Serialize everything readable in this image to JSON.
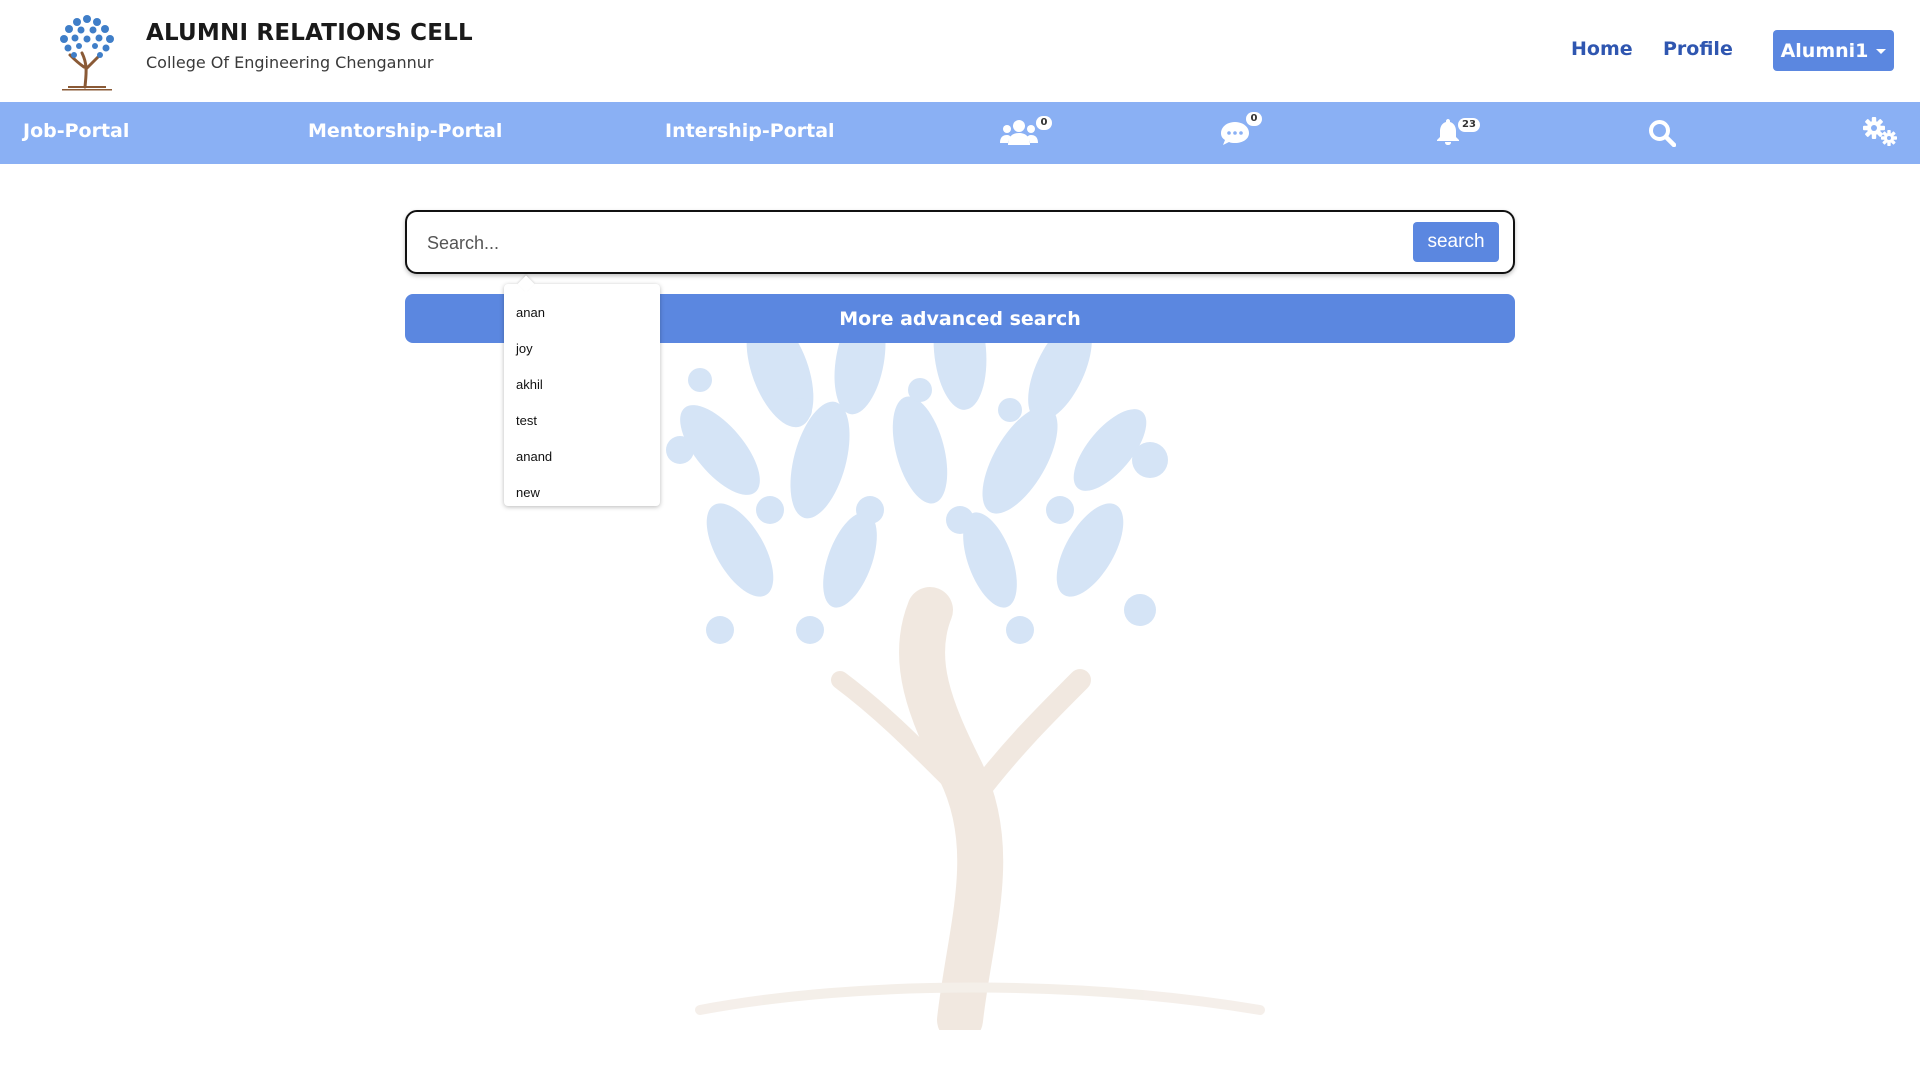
{
  "header": {
    "title": "ALUMNI RELATIONS CELL",
    "subtitle": "College Of Engineering Chengannur",
    "nav": {
      "home": "Home",
      "profile": "Profile"
    },
    "user_menu": "Alumni1"
  },
  "navbar": {
    "job_portal": "Job-Portal",
    "mentorship_portal": "Mentorship-Portal",
    "internship_portal": "Intership-Portal",
    "connections_count": "0",
    "messages_count": "0",
    "notifications_count": "23",
    "icons": [
      "users-icon",
      "chat-icon",
      "bell-icon",
      "search-icon",
      "gears-icon"
    ]
  },
  "search": {
    "placeholder": "Search...",
    "value": "",
    "button_label": "search",
    "advanced_label": "More advanced search",
    "suggestions": [
      "anan",
      "joy",
      "akhil",
      "test",
      "anand",
      "new"
    ]
  },
  "colors": {
    "primary": "#5b87e0",
    "navbar": "#8ab0f4",
    "link": "#2f56b0"
  }
}
